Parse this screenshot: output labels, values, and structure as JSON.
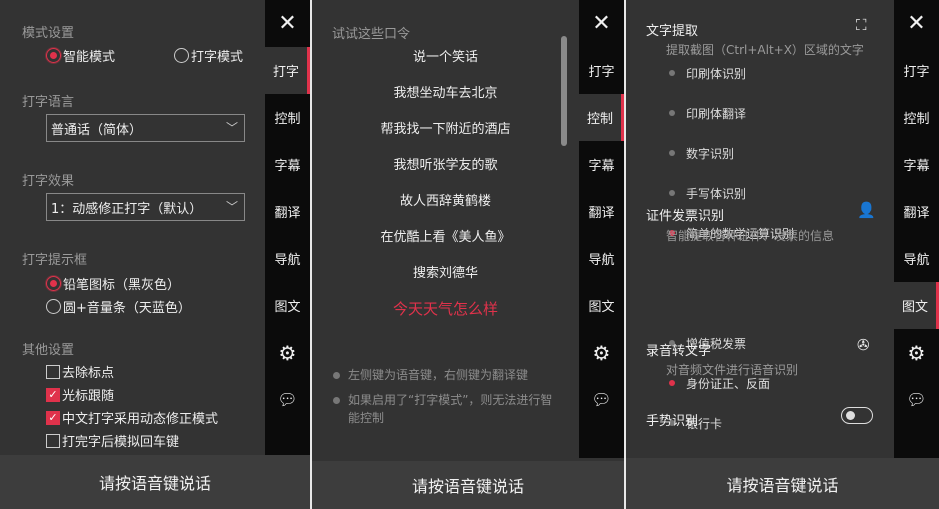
{
  "sidebar": {
    "close": "✕",
    "items": [
      "打字",
      "控制",
      "字幕",
      "翻译",
      "导航",
      "图文"
    ],
    "settings_icon": "gear-icon",
    "chat_icon": "chat-bubble-icon"
  },
  "footer_label": "请按语音键说话",
  "typing_panel": {
    "mode_title": "模式设置",
    "mode_smart": "智能模式",
    "mode_typing": "打字模式",
    "lang_title": "打字语言",
    "lang_value": "普通话（简体）",
    "effect_title": "打字效果",
    "effect_value": "1：动感修正打字（默认）",
    "prompt_title": "打字提示框",
    "prompt_pencil": "铅笔图标（黑灰色）",
    "prompt_circle": "圆+音量条（天蓝色）",
    "other_title": "其他设置",
    "other": [
      "去除标点",
      "光标跟随",
      "中文打字采用动态修正模式",
      "打完字后模拟回车键"
    ],
    "other_checked": [
      false,
      true,
      true,
      false
    ]
  },
  "control_panel": {
    "title": "试试这些口令",
    "commands": [
      "说一个笑话",
      "我想坐动车去北京",
      "帮我找一下附近的酒店",
      "我想听张学友的歌",
      "故人西辞黄鹤楼",
      "在优酷上看《美人鱼》",
      "搜索刘德华",
      "今天天气怎么样"
    ],
    "notes": [
      "左侧键为语音键，右侧键为翻译键",
      "如果启用了“打字模式”，则无法进行智能控制"
    ]
  },
  "image_panel": {
    "ocr_title": "文字提取",
    "ocr_sub": "提取截图（Ctrl+Alt+X）区域的文字",
    "ocr_items": [
      "印刷体识别",
      "印刷体翻译",
      "数字识别",
      "手写体识别",
      "简单的数学运算识别"
    ],
    "id_title": "证件发票识别",
    "id_sub": "智能提取各种证件、发票的信息",
    "id_items": [
      "增值税发票",
      "身份证正、反面",
      "银行卡"
    ],
    "audio_title": "录音转文字",
    "audio_sub": "对音频文件进行语音识别",
    "gesture_title": "手势识别",
    "gesture_enabled": false
  },
  "colors": {
    "accent": "#e0324b",
    "panel": "#333333",
    "sidebar": "#0b0b0b"
  }
}
